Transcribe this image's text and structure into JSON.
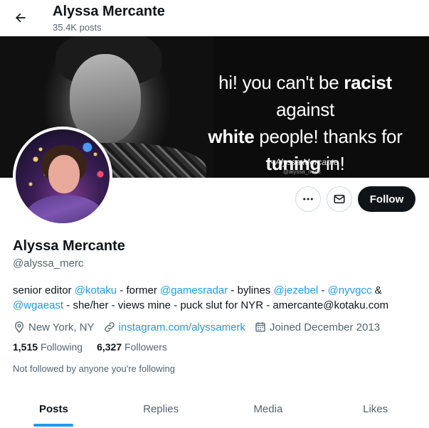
{
  "header": {
    "name": "Alyssa Mercante",
    "post_count": "35.4K posts"
  },
  "banner": {
    "quote_parts": [
      "hi! you can't be ",
      "racist",
      " against",
      "white",
      " people! thanks for",
      "tuning",
      " in!"
    ],
    "attribution": "- Alyssa Mercante",
    "watermark_handle": "@alyssa_merc"
  },
  "profile": {
    "display_name": "Alyssa Mercante",
    "handle": "@alyssa_merc",
    "follow_label": "Follow",
    "bio": {
      "line1": [
        {
          "text": "senior editor ",
          "mention": false
        },
        {
          "text": "@kotaku",
          "mention": true
        },
        {
          "text": " - former ",
          "mention": false
        },
        {
          "text": "@gamesradar",
          "mention": true
        },
        {
          "text": " - bylines ",
          "mention": false
        },
        {
          "text": "@jezebel",
          "mention": true
        },
        {
          "text": " - ",
          "mention": false
        },
        {
          "text": "@nyvgcc",
          "mention": true
        },
        {
          "text": " &",
          "mention": false
        }
      ],
      "line2": [
        {
          "text": "@wgaeast",
          "mention": true
        },
        {
          "text": " - she/her - views mine - puck slut for NYR - amercante@kotaku.com",
          "mention": false
        }
      ]
    },
    "location": "New York, NY",
    "website": "instagram.com/alyssamerk",
    "joined": "Joined December 2013",
    "following_count": "1,515",
    "following_label": "Following",
    "followers_count": "6,327",
    "followers_label": "Followers",
    "followed_note": "Not followed by anyone you're following"
  },
  "tabs": [
    {
      "label": "Posts",
      "active": true
    },
    {
      "label": "Replies",
      "active": false
    },
    {
      "label": "Media",
      "active": false
    },
    {
      "label": "Likes",
      "active": false
    }
  ],
  "colors": {
    "accent": "#1d9bf0",
    "text_primary": "#0f1419",
    "text_secondary": "#536471",
    "button_dark": "#0f1419"
  },
  "icons": [
    "back-arrow-icon",
    "more-icon",
    "mail-icon",
    "location-icon",
    "link-icon",
    "calendar-icon"
  ]
}
